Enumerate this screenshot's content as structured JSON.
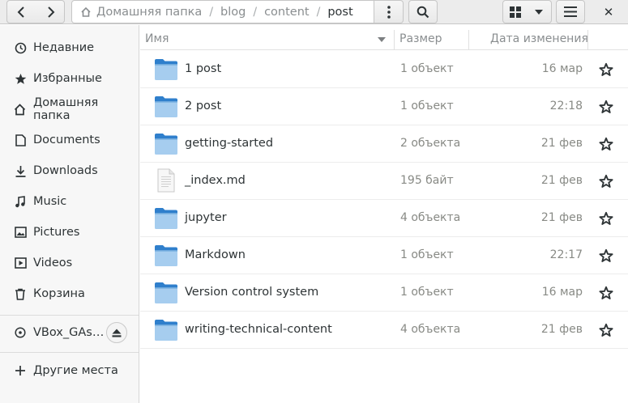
{
  "header": {
    "breadcrumbs": [
      "Домашняя папка",
      "blog",
      "content",
      "post"
    ],
    "close_label": "✕"
  },
  "sidebar": {
    "items": [
      {
        "label": "Недавние",
        "icon": "clock-icon"
      },
      {
        "label": "Избранные",
        "icon": "star-icon"
      },
      {
        "label": "Домашняя папка",
        "icon": "home-icon"
      },
      {
        "label": "Documents",
        "icon": "document-icon"
      },
      {
        "label": "Downloads",
        "icon": "download-icon"
      },
      {
        "label": "Music",
        "icon": "music-icon"
      },
      {
        "label": "Pictures",
        "icon": "picture-icon"
      },
      {
        "label": "Videos",
        "icon": "video-icon"
      },
      {
        "label": "Корзина",
        "icon": "trash-icon"
      }
    ],
    "device": {
      "label": "VBox_GAs…",
      "icon": "disc-icon"
    },
    "other_places": "Другие места"
  },
  "columns": {
    "name": "Имя",
    "size": "Размер",
    "modified": "Дата изменения"
  },
  "files": [
    {
      "name": "1 post",
      "size": "1 объект",
      "date": "16 мар",
      "type": "folder"
    },
    {
      "name": "2 post",
      "size": "1 объект",
      "date": "22:18",
      "type": "folder"
    },
    {
      "name": "getting-started",
      "size": "2 объекта",
      "date": "21 фев",
      "type": "folder"
    },
    {
      "name": "_index.md",
      "size": "195 байт",
      "date": "21 фев",
      "type": "file"
    },
    {
      "name": "jupyter",
      "size": "4 объекта",
      "date": "21 фев",
      "type": "folder"
    },
    {
      "name": "Markdown",
      "size": "1 объект",
      "date": "22:17",
      "type": "folder"
    },
    {
      "name": "Version control system",
      "size": "1 объект",
      "date": "16 мар",
      "type": "folder"
    },
    {
      "name": "writing-technical-content",
      "size": "4 объекта",
      "date": "21 фев",
      "type": "folder"
    }
  ],
  "colors": {
    "folder_blue": "#3d8fd6",
    "accent": "#2e3436"
  }
}
